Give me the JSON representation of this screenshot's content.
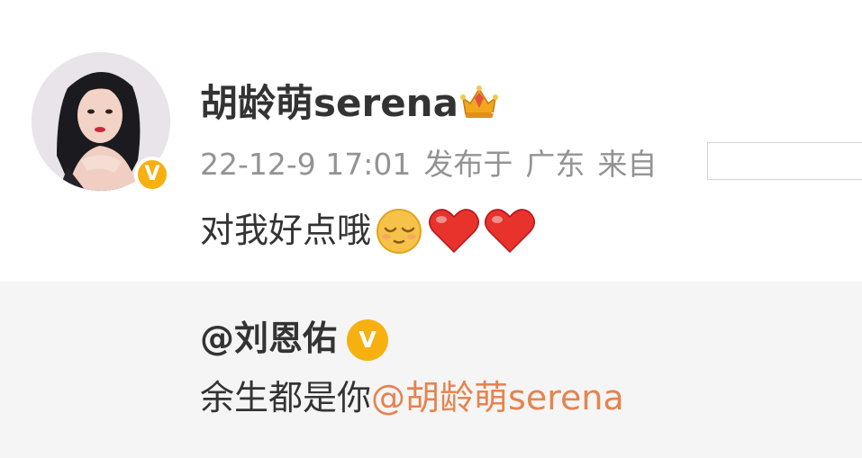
{
  "post": {
    "username": "胡龄萌serena",
    "verified_badge": "V",
    "crown_icon": "crown-icon",
    "timestamp": "22-12-9 17:01",
    "published_at": "发布于",
    "location": "广东",
    "source_label": "来自",
    "text": "对我好点哦",
    "emojis": [
      "sleepy-face-emoji",
      "red-heart-emoji",
      "red-heart-emoji"
    ]
  },
  "repost": {
    "username": "@刘恩佑",
    "verified_badge": "V",
    "text": "余生都是你",
    "mention": "@胡龄萌serena"
  },
  "colors": {
    "username": "#333333",
    "meta": "#939393",
    "mention": "#e6834f",
    "badge": "#f6b111",
    "repost_bg": "#f5f5f5"
  }
}
